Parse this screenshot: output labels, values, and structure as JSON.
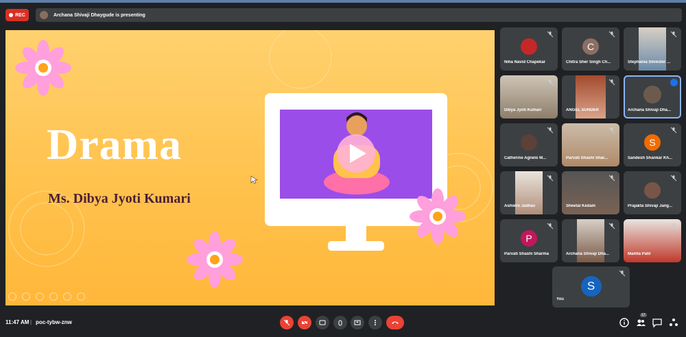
{
  "meeting": {
    "rec_label": "REC",
    "presenting_text": "Archana Shivaji Dhaygude is presenting",
    "time": "11:47 AM",
    "separator": "|",
    "code": "poc-tybw-znw",
    "participants_count": "17"
  },
  "slide": {
    "title": "Drama",
    "subtitle": "Ms. Dibya Jyoti Kumari",
    "colors": {
      "background": "#ffc24d",
      "purple": "#9b4dea",
      "pink": "#ff7bb8",
      "flower": "#ff9fdc"
    }
  },
  "participants": [
    {
      "name": "Niha Navid Chapekar",
      "kind": "photo"
    },
    {
      "name": "Chitra Sher Singh Ch...",
      "kind": "initial",
      "initial": "C",
      "color": "#8d6e63"
    },
    {
      "name": "Stephania Silvester ...",
      "kind": "photo"
    },
    {
      "name": "Dibya Jyoti Kumari",
      "kind": "photo"
    },
    {
      "name": "ANGEL SUNDER",
      "kind": "photo"
    },
    {
      "name": "Archana Shivaji Dha...",
      "kind": "photo",
      "speaking": true
    },
    {
      "name": "Catherine Agnelo M...",
      "kind": "photo"
    },
    {
      "name": "Parvati Shashi Shar...",
      "kind": "photo"
    },
    {
      "name": "Sandesh Shankar Kh...",
      "kind": "initial",
      "initial": "S",
      "color": "#ef6c00"
    },
    {
      "name": "Ashwini Jadhav",
      "kind": "photo"
    },
    {
      "name": "Sheetal Kedam",
      "kind": "photo"
    },
    {
      "name": "Prajakta Shivaji Jang...",
      "kind": "photo"
    },
    {
      "name": "Parvati Shashi Sharma",
      "kind": "initial",
      "initial": "P",
      "color": "#c2185b"
    },
    {
      "name": "Archana Shivaji Dha...",
      "kind": "photo"
    },
    {
      "name": "Mamta Patil",
      "kind": "photo"
    },
    {
      "name": "You",
      "kind": "initial",
      "initial": "S",
      "color": "#1565c0"
    }
  ],
  "controls": {
    "mic": "mic-off-icon",
    "camera": "camera-off-icon",
    "captions": "captions-icon",
    "hand": "raise-hand-icon",
    "present": "present-icon",
    "more": "more-icon",
    "end": "end-call-icon"
  }
}
